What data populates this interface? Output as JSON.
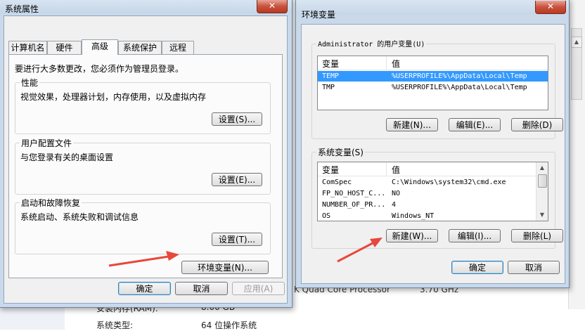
{
  "background": {
    "cpu_text": "K Quad Core Processor",
    "cpu_speed": "3.70 GHz",
    "ram_label": "安装内存(RAM):",
    "ram_value": "8.00 GB",
    "systype_label": "系统类型:",
    "systype_value": "64 位操作系统"
  },
  "sys_props": {
    "title": "系统属性",
    "close": "✕",
    "tabs": [
      "计算机名",
      "硬件",
      "高级",
      "系统保护",
      "远程"
    ],
    "admin_note": "要进行大多数更改，您必须作为管理员登录。",
    "performance": {
      "label": "性能",
      "desc": "视觉效果，处理器计划，内存使用，以及虚拟内存",
      "button": "设置(S)..."
    },
    "profiles": {
      "label": "用户配置文件",
      "desc": "与您登录有关的桌面设置",
      "button": "设置(E)..."
    },
    "startup": {
      "label": "启动和故障恢复",
      "desc": "系统启动、系统失败和调试信息",
      "button": "设置(T)..."
    },
    "env_button": "环境变量(N)...",
    "ok": "确定",
    "cancel": "取消",
    "apply": "应用(A)"
  },
  "env_vars": {
    "title": "环境变量",
    "close": "✕",
    "user_group_label": "Administrator 的用户变量(U)",
    "col_var": "变量",
    "col_val": "值",
    "user_rows": [
      {
        "var": "TEMP",
        "val": "%USERPROFILE%\\AppData\\Local\\Temp"
      },
      {
        "var": "TMP",
        "val": "%USERPROFILE%\\AppData\\Local\\Temp"
      }
    ],
    "user_buttons": {
      "new": "新建(N)...",
      "edit": "编辑(E)...",
      "delete": "删除(D)"
    },
    "sys_group_label": "系统变量(S)",
    "sys_rows": [
      {
        "var": "ComSpec",
        "val": "C:\\Windows\\system32\\cmd.exe"
      },
      {
        "var": "FP_NO_HOST_C...",
        "val": "NO"
      },
      {
        "var": "NUMBER_OF_PR...",
        "val": "4"
      },
      {
        "var": "OS",
        "val": "Windows_NT"
      }
    ],
    "sys_buttons": {
      "new": "新建(W)...",
      "edit": "编辑(I)...",
      "delete": "删除(L)"
    },
    "ok": "确定",
    "cancel": "取消"
  },
  "colors": {
    "selection": "#3399ff",
    "arrow": "#e8473c",
    "close_button": "#c9513b"
  }
}
